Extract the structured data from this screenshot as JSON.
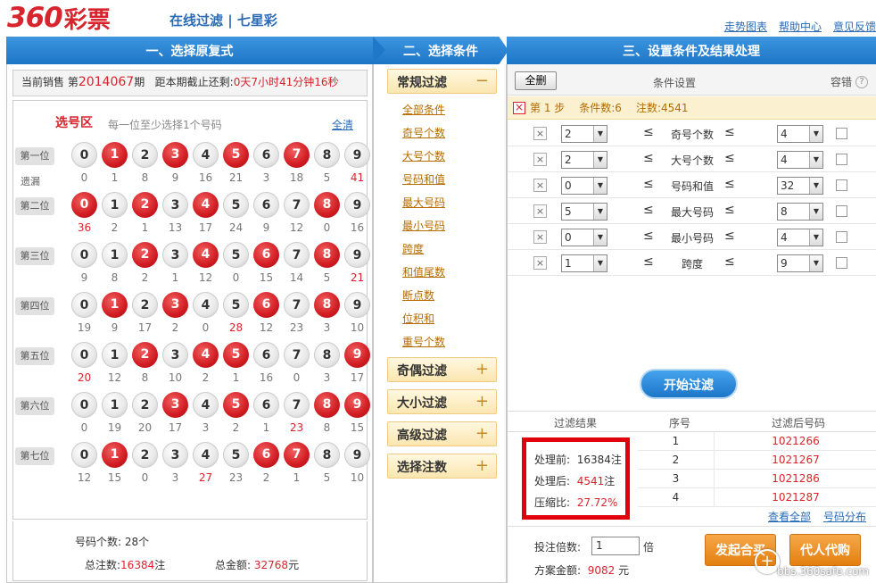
{
  "header": {
    "logo_num": "360",
    "logo_cn": "彩票",
    "page_title": "在线过滤 | 七星彩",
    "links": [
      "走势图表",
      "帮助中心",
      "意见反馈"
    ]
  },
  "sections": {
    "s1": "一、选择原复式",
    "s2": "二、选择条件",
    "s3": "三、设置条件及结果处理"
  },
  "sale": {
    "prefix": "当前销售 第",
    "issue": "2014067",
    "suffix": "期",
    "deadline_label": "距本期截止还剩:",
    "deadline": "0天7小时41分钟16秒"
  },
  "zone": {
    "title": "选号区",
    "hint": "每一位至少选择1个号码",
    "clear": "全清",
    "miss_label": "遗漏"
  },
  "positions": [
    {
      "label": "第一位",
      "selected": [
        1,
        3,
        5,
        7
      ],
      "miss": [
        "0",
        "1",
        "8",
        "9",
        "16",
        "21",
        "3",
        "18",
        "5",
        "41"
      ],
      "hot": [
        9
      ]
    },
    {
      "label": "第二位",
      "selected": [
        0,
        2,
        4,
        8
      ],
      "miss": [
        "36",
        "2",
        "1",
        "13",
        "17",
        "24",
        "9",
        "12",
        "0",
        "16"
      ],
      "hot": [
        0
      ]
    },
    {
      "label": "第三位",
      "selected": [
        2,
        4,
        6,
        8
      ],
      "miss": [
        "9",
        "8",
        "2",
        "1",
        "12",
        "0",
        "15",
        "14",
        "5",
        "21"
      ],
      "hot": [
        9
      ]
    },
    {
      "label": "第四位",
      "selected": [
        1,
        3,
        6,
        8
      ],
      "miss": [
        "19",
        "9",
        "17",
        "2",
        "0",
        "28",
        "12",
        "23",
        "3",
        "10"
      ],
      "hot": [
        5
      ]
    },
    {
      "label": "第五位",
      "selected": [
        2,
        4,
        5,
        9
      ],
      "miss": [
        "20",
        "12",
        "8",
        "10",
        "2",
        "1",
        "16",
        "0",
        "3",
        "17"
      ],
      "hot": [
        0
      ]
    },
    {
      "label": "第六位",
      "selected": [
        3,
        5,
        8,
        9
      ],
      "miss": [
        "0",
        "19",
        "20",
        "17",
        "3",
        "2",
        "1",
        "23",
        "8",
        "15"
      ],
      "hot": [
        7
      ]
    },
    {
      "label": "第七位",
      "selected": [
        1,
        6,
        7
      ],
      "miss": [
        "12",
        "15",
        "0",
        "3",
        "27",
        "23",
        "2",
        "1",
        "5",
        "10"
      ],
      "hot": [
        4
      ]
    }
  ],
  "stats": {
    "count_label": "号码个数:",
    "count": "28个",
    "notes_label": "总注数:",
    "notes": "16384",
    "notes_unit": "注",
    "amount_label": "总金额:",
    "amount": "32768",
    "amount_unit": "元"
  },
  "conditions": {
    "groups": [
      {
        "label": "常规过滤",
        "sign": "−"
      },
      {
        "label": "奇偶过滤",
        "sign": "+"
      },
      {
        "label": "大小过滤",
        "sign": "+"
      },
      {
        "label": "高级过滤",
        "sign": "+"
      },
      {
        "label": "选择注数",
        "sign": "+"
      }
    ],
    "items": [
      "全部条件",
      "奇号个数",
      "大号个数",
      "号码和值",
      "最大号码",
      "最小号码",
      "跨度",
      "和值尾数",
      "断点数",
      "位积和",
      "重号个数"
    ]
  },
  "settings": {
    "all_button": "全删",
    "col_title": "条件设置",
    "tolerance": "容错",
    "qmark": "?",
    "step_label": "第 1 步",
    "cond_count": "条件数:6",
    "notes": "注数:4541",
    "rows": [
      {
        "min": "2",
        "name": "奇号个数",
        "max": "4"
      },
      {
        "min": "2",
        "name": "大号个数",
        "max": "4"
      },
      {
        "min": "0",
        "name": "号码和值",
        "max": "32"
      },
      {
        "min": "5",
        "name": "最大号码",
        "max": "8"
      },
      {
        "min": "0",
        "name": "最小号码",
        "max": "4"
      },
      {
        "min": "1",
        "name": "跨度",
        "max": "9"
      }
    ],
    "le_sign": "≤",
    "x_sign": "×",
    "dropdown_arrow": "▼"
  },
  "filter": {
    "start": "开始过滤",
    "col_result": "过滤结果",
    "col_no": "序号",
    "col_code": "过滤后号码"
  },
  "results": [
    {
      "no": "1",
      "code": "1021266"
    },
    {
      "no": "2",
      "code": "1021267"
    },
    {
      "no": "3",
      "code": "1021286"
    },
    {
      "no": "4",
      "code": "1021287"
    }
  ],
  "summary": {
    "before_label": "处理前:",
    "before": "16384注",
    "after_label": "处理后:",
    "after": "4541",
    "after_unit": "注",
    "ratio_label": "压缩比:",
    "ratio": "27.72%"
  },
  "result_links": {
    "all": "查看全部",
    "dist": "号码分布"
  },
  "bottom": {
    "mult_label": "投注倍数:",
    "mult": "1",
    "mult_unit": "倍",
    "amount_label": "方案金额:",
    "amount": "9082",
    "amount_unit": "元",
    "btn1": "发起合买",
    "btn2": "代人代购"
  },
  "watermark": "bbs.360safe.com"
}
